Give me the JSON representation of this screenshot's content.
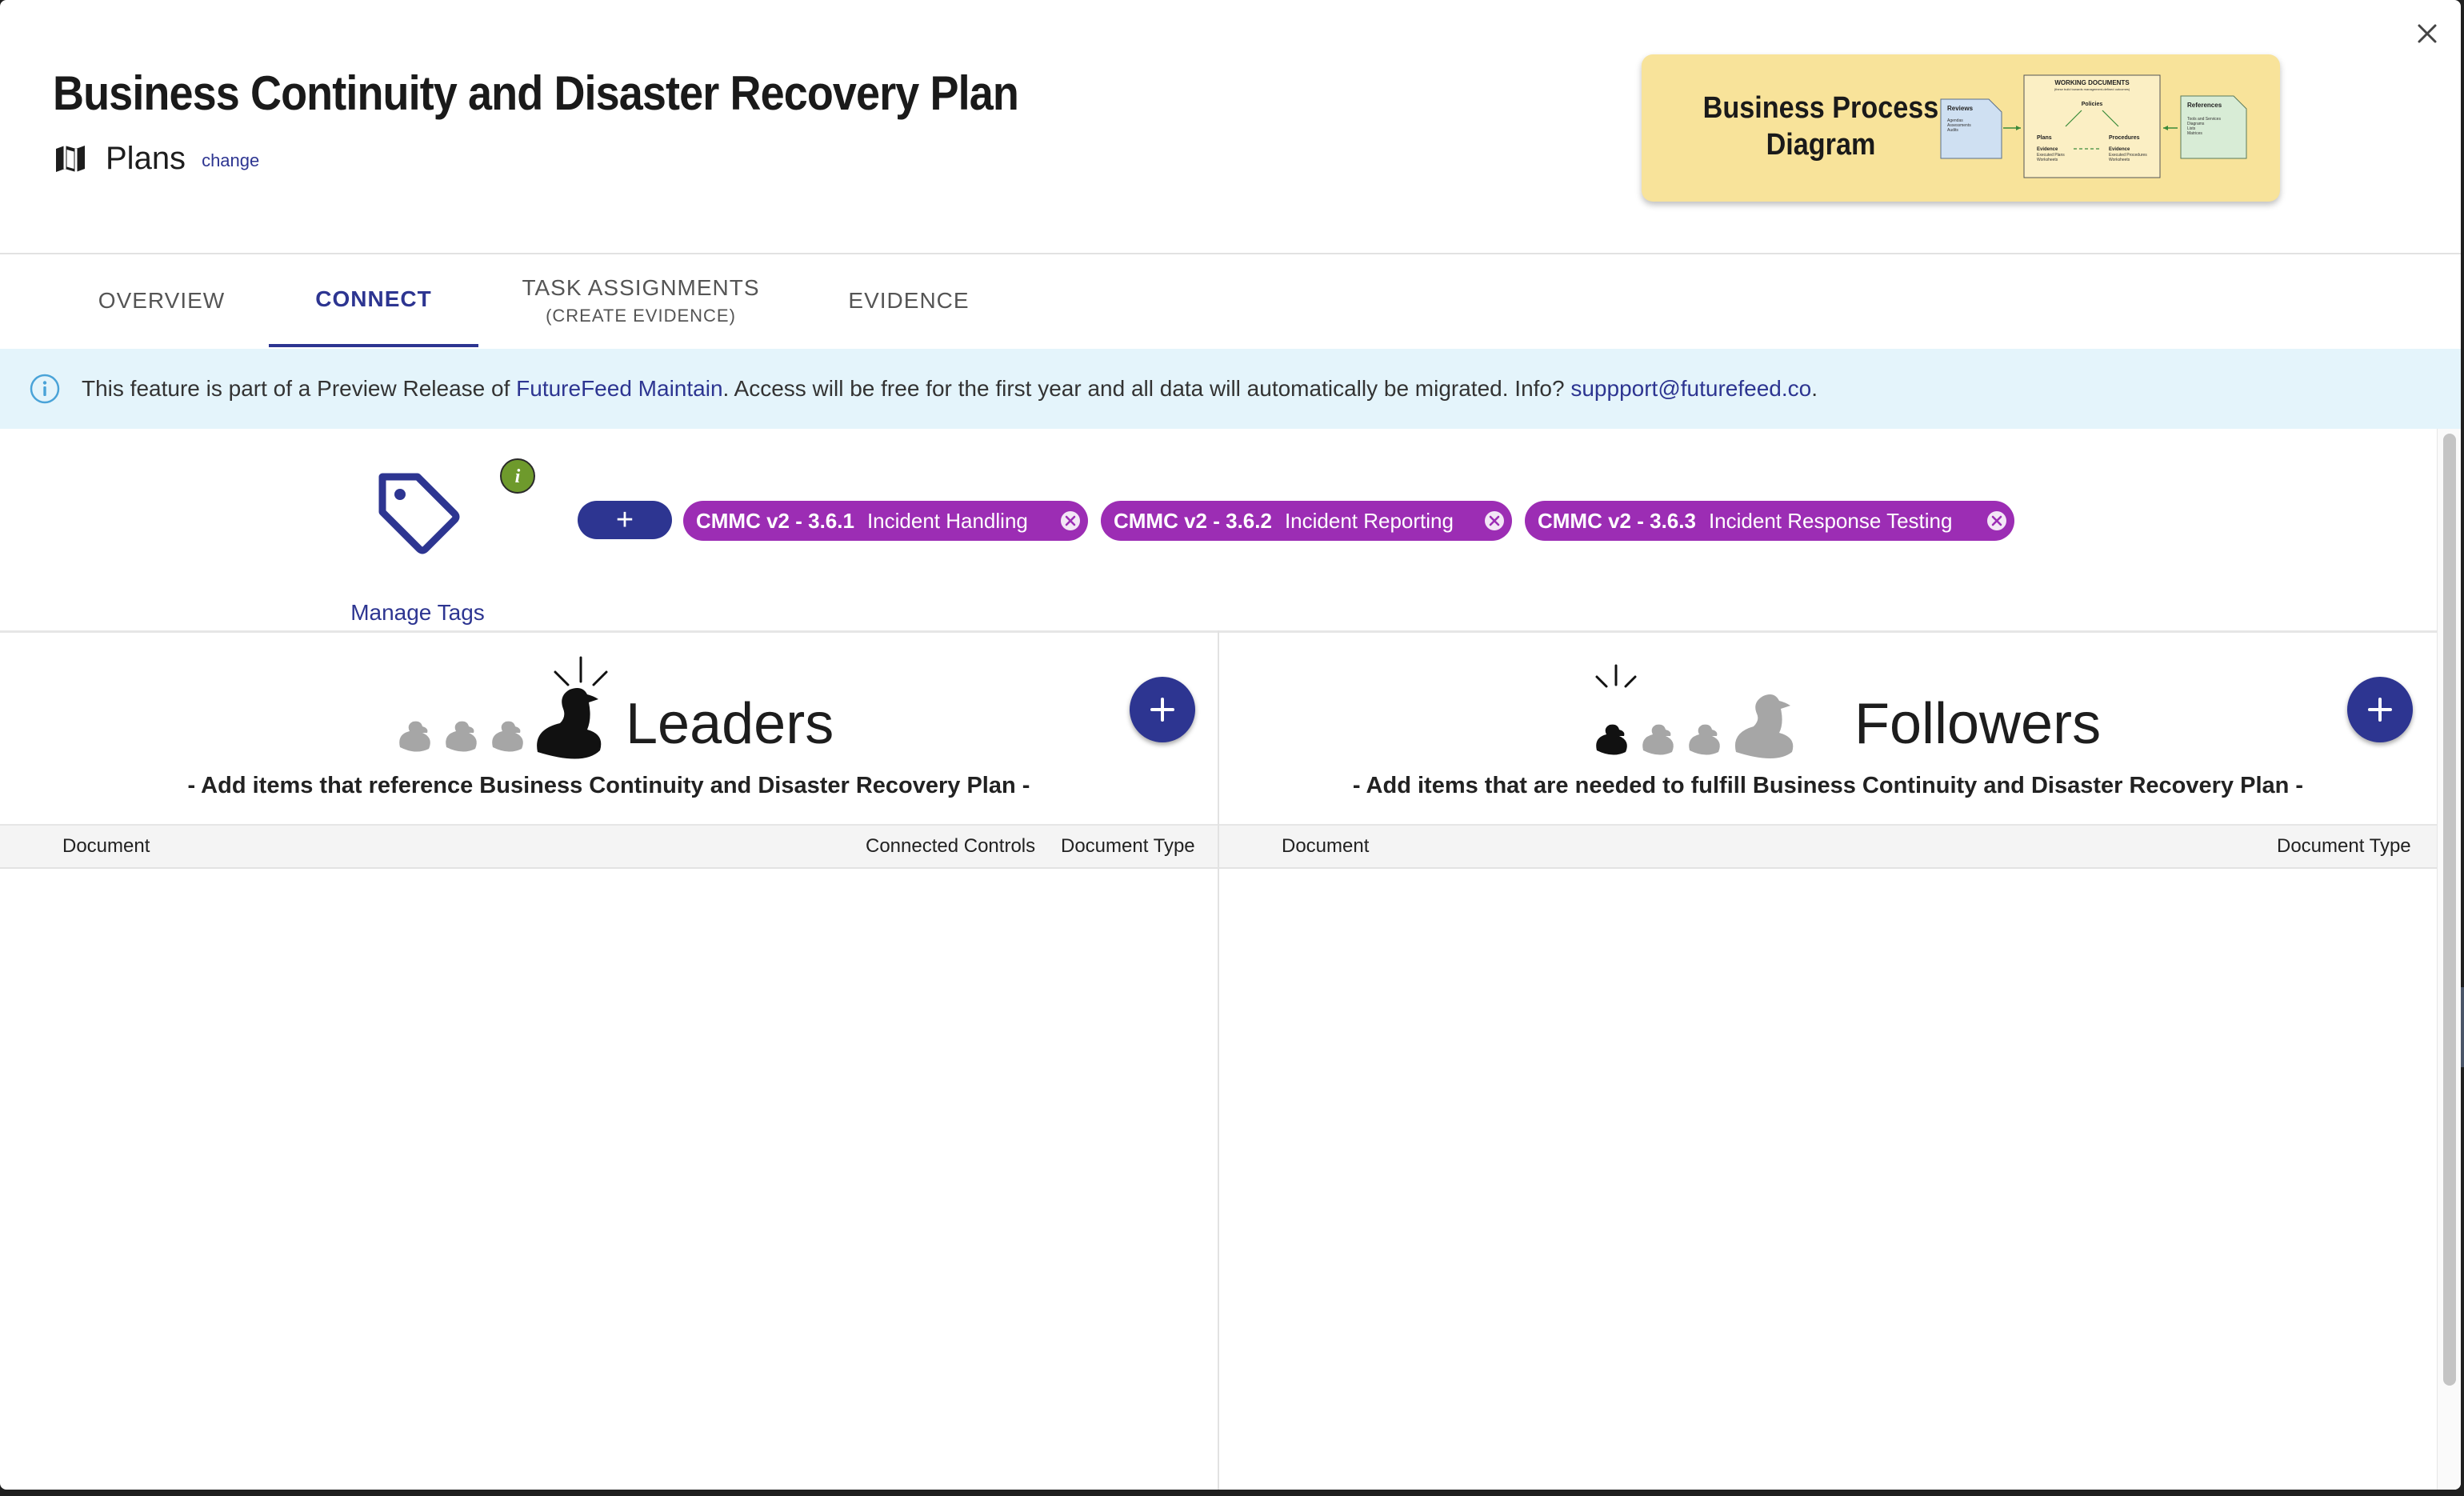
{
  "header": {
    "title": "Business Continuity and Disaster Recovery Plan",
    "category_label": "Plans",
    "change_link": "change",
    "diagram_card": {
      "label": "Business Process Diagram",
      "diagram_texts": {
        "reviews": "Reviews",
        "reviews_items": [
          "Agendas",
          "Assessments",
          "Audits"
        ],
        "working_documents": "WORKING DOCUMENTS",
        "working_sub": "(these build towards management-defined outcomes)",
        "policies": "Policies",
        "plans": "Plans",
        "procedures": "Procedures",
        "evidence_left": "Evidence",
        "evidence_left_items": [
          "Executed Plans",
          "Worksheets"
        ],
        "evidence_right": "Evidence",
        "evidence_right_items": [
          "Executed Procedures",
          "Worksheets"
        ],
        "references": "References",
        "references_items": [
          "Tools and Services",
          "Diagrams",
          "Lists",
          "Matrices"
        ]
      }
    }
  },
  "tabs": [
    {
      "label": "OVERVIEW",
      "sub": "",
      "active": false
    },
    {
      "label": "CONNECT",
      "sub": "",
      "active": true
    },
    {
      "label": "TASK ASSIGNMENTS",
      "sub": "(CREATE EVIDENCE)",
      "active": false
    },
    {
      "label": "EVIDENCE",
      "sub": "",
      "active": false
    }
  ],
  "info_banner": {
    "text_1": "This feature is part of a Preview Release of ",
    "link_product": "FutureFeed Maintain",
    "text_2": ". Access will be free for the first year and all data will automatically be migrated. Info? ",
    "link_email": "suppport@futurefeed.co",
    "text_3": "."
  },
  "tags": {
    "manage_label": "Manage Tags",
    "add_label": "+",
    "chips": [
      {
        "code": "CMMC v2 - 3.6.1",
        "name": "Incident Handling"
      },
      {
        "code": "CMMC v2 - 3.6.2",
        "name": "Incident Reporting"
      },
      {
        "code": "CMMC v2 - 3.6.3",
        "name": "Incident Response Testing"
      }
    ]
  },
  "leaders": {
    "title": "Leaders",
    "subtitle": "- Add items that reference Business Continuity and Disaster Recovery Plan -",
    "columns": [
      "Document",
      "Connected Controls",
      "Document Type"
    ],
    "rows": []
  },
  "followers": {
    "title": "Followers",
    "subtitle": "- Add items that are needed to fulfill Business Continuity and Disaster Recovery Plan -",
    "columns": [
      "Document",
      "Document Type"
    ],
    "rows": []
  },
  "colors": {
    "primary": "#2d3591",
    "tag_chip": "#9c2db4",
    "banner_bg": "#e4f4fb",
    "card_bg": "#f8e39a",
    "info_green": "#6e9a2c"
  }
}
